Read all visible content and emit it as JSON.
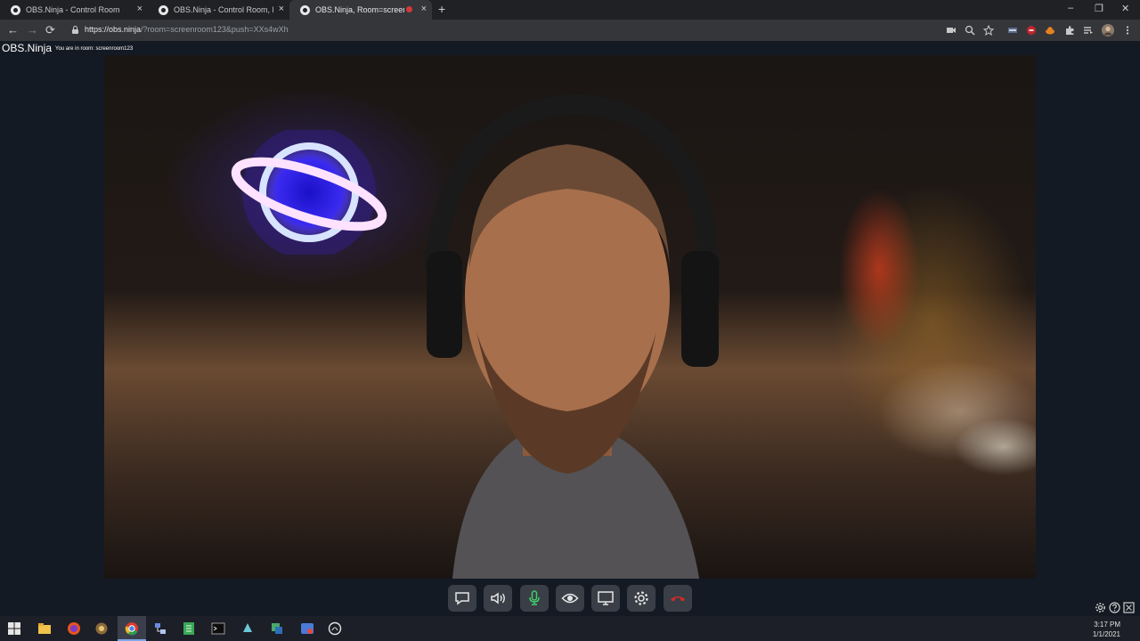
{
  "browser": {
    "tabs": [
      {
        "title": "OBS.Ninja - Control Room",
        "active": false
      },
      {
        "title": "OBS.Ninja - Control Room, Room",
        "active": false
      },
      {
        "title": "OBS.Ninja, Room=screenroom",
        "active": true
      }
    ],
    "close_glyph": "×",
    "new_tab_glyph": "+",
    "url_host": "https://obs.ninja",
    "url_path": "/?room=screenroom123&push=XXs4wXh",
    "window_controls": {
      "minimize": "–",
      "restore": "❐",
      "close": "✕"
    },
    "nav": {
      "back": "←",
      "forward": "→",
      "reload": "⟳"
    }
  },
  "app": {
    "brand": "OBS.Ninja",
    "room_status": "You are in room: screenroom123"
  },
  "controls": [
    {
      "name": "chat-button",
      "icon": "chat-icon",
      "color": "#e6e6e6"
    },
    {
      "name": "speaker-button",
      "icon": "speaker-icon",
      "color": "#e6e6e6"
    },
    {
      "name": "microphone-button",
      "icon": "microphone-icon",
      "color": "#3ecf6a"
    },
    {
      "name": "camera-visibility-button",
      "icon": "eye-icon",
      "color": "#e6e6e6"
    },
    {
      "name": "screen-share-button",
      "icon": "monitor-icon",
      "color": "#e6e6e6"
    },
    {
      "name": "settings-button",
      "icon": "gear-icon",
      "color": "#e6e6e6"
    },
    {
      "name": "hangup-button",
      "icon": "phone-hangup-icon",
      "color": "#d22a2a"
    }
  ],
  "corner_icons": [
    "gear-icon",
    "help-icon",
    "fullscreen-icon"
  ],
  "taskbar": {
    "time": "3:17 PM",
    "date": "1/1/2021",
    "apps": [
      "windows-start-icon",
      "file-explorer-icon",
      "firefox-icon",
      "app-icon",
      "chrome-icon",
      "network-icon",
      "spreadsheet-icon",
      "terminal-icon",
      "app-icon",
      "app-icon",
      "app-icon",
      "app-icon"
    ]
  }
}
